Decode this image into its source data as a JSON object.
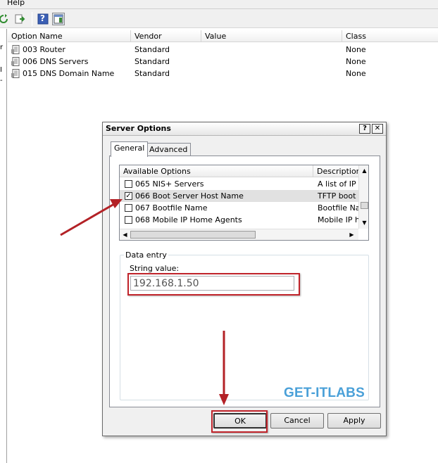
{
  "menu": {
    "help": "Help"
  },
  "toolbar": {
    "icons": [
      "refresh-icon",
      "export-list-icon",
      "help-icon",
      "show-hide-pane-icon"
    ],
    "help_glyph": "?"
  },
  "left_pane": {
    "fragments": [
      "r",
      "I",
      "-"
    ]
  },
  "list": {
    "columns": [
      "Option Name",
      "Vendor",
      "Value",
      "Class"
    ],
    "rows": [
      {
        "name": "003 Router",
        "vendor": "Standard",
        "value": "",
        "class": "None"
      },
      {
        "name": "006 DNS Servers",
        "vendor": "Standard",
        "value": "",
        "class": "None"
      },
      {
        "name": "015 DNS Domain Name",
        "vendor": "Standard",
        "value": "",
        "class": "None"
      }
    ]
  },
  "dialog": {
    "title": "Server Options",
    "help_btn": "?",
    "close_btn": "✕",
    "tabs": [
      "General",
      "Advanced"
    ],
    "available_options": {
      "headers": [
        "Available Options",
        "Description"
      ],
      "rows": [
        {
          "checked": false,
          "name": "065 NIS+ Servers",
          "desc": "A list of IP a"
        },
        {
          "checked": true,
          "name": "066 Boot Server Host Name",
          "desc": "TFTP boot s"
        },
        {
          "checked": false,
          "name": "067 Bootfile Name",
          "desc": "Bootfile Nan"
        },
        {
          "checked": false,
          "name": "068 Mobile IP Home Agents",
          "desc": "Mobile IP ho"
        }
      ],
      "check_mark": "✓"
    },
    "data_entry": {
      "legend": "Data entry",
      "label": "String value:",
      "value": "192.168.1.50"
    },
    "watermark": "GET-ITLABS",
    "buttons": {
      "ok": "OK",
      "cancel": "Cancel",
      "apply": "Apply"
    }
  },
  "colors": {
    "annotation_red": "#c0232a",
    "watermark_blue": "#4aa0d8"
  }
}
